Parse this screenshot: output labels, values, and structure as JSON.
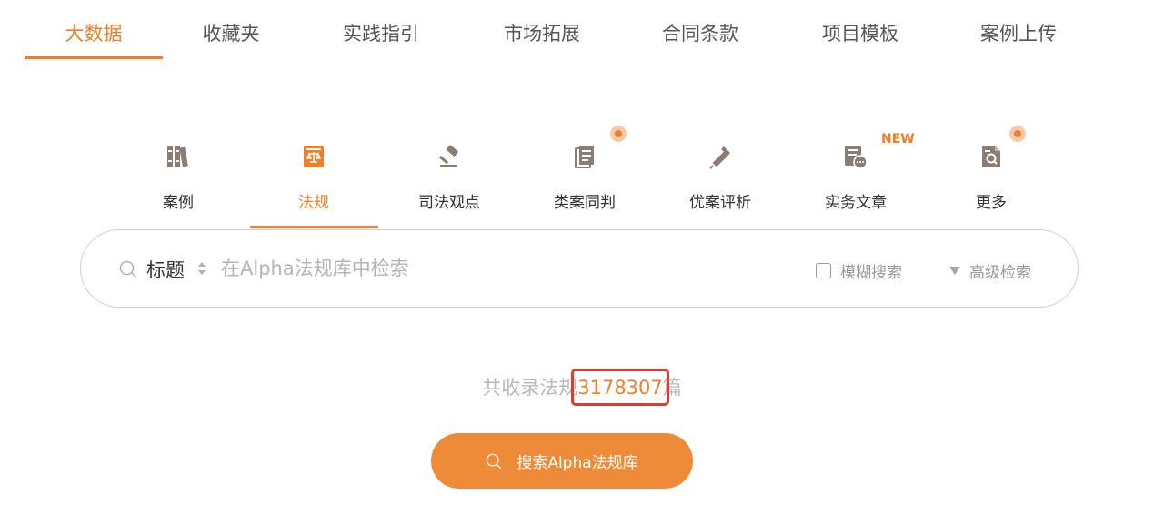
{
  "top_tabs": [
    {
      "label": "大数据",
      "active": true
    },
    {
      "label": "收藏夹",
      "active": false
    },
    {
      "label": "实践指引",
      "active": false
    },
    {
      "label": "市场拓展",
      "active": false
    },
    {
      "label": "合同条款",
      "active": false
    },
    {
      "label": "项目模板",
      "active": false
    },
    {
      "label": "案例上传",
      "active": false
    }
  ],
  "categories": [
    {
      "label": "案例",
      "icon": "books-icon",
      "active": false
    },
    {
      "label": "法规",
      "icon": "law-book-icon",
      "active": true
    },
    {
      "label": "司法观点",
      "icon": "gavel-icon",
      "active": false
    },
    {
      "label": "类案同判",
      "icon": "document-stack-icon",
      "active": false,
      "dot": true
    },
    {
      "label": "优案评析",
      "icon": "pen-icon",
      "active": false
    },
    {
      "label": "实务文章",
      "icon": "article-chat-icon",
      "active": false,
      "badge": "NEW"
    },
    {
      "label": "更多",
      "icon": "search-document-icon",
      "active": false,
      "dot": true
    }
  ],
  "search": {
    "field": "标题",
    "placeholder": "在Alpha法规库中检索",
    "fuzzy_label": "模糊搜索",
    "advanced_label": "高级检索"
  },
  "count": {
    "prefix": "共收录法规",
    "value": "3178307",
    "suffix": "篇"
  },
  "button": {
    "label": "搜索Alpha法规库"
  },
  "colors": {
    "accent": "#ee7f2d",
    "icon_gray": "#8c7d73",
    "highlight_box": "#e03a2f"
  }
}
